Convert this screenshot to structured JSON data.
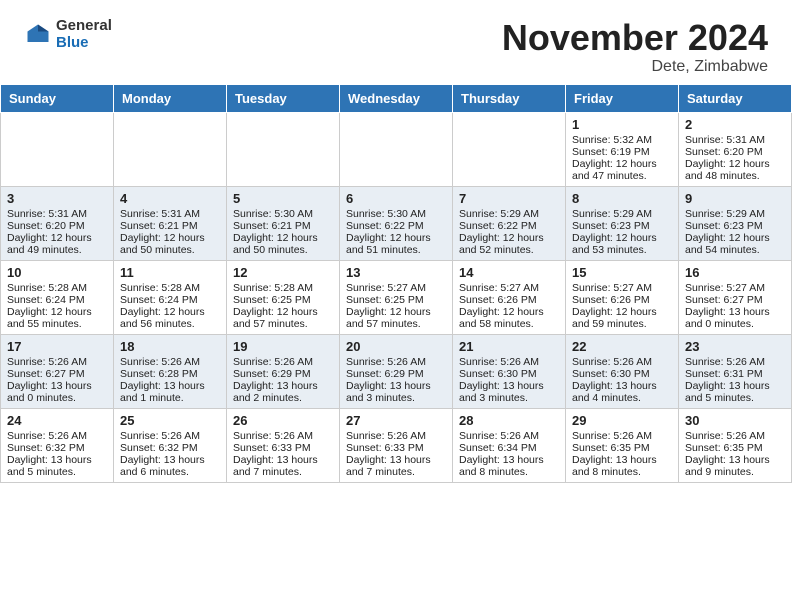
{
  "header": {
    "logo_general": "General",
    "logo_blue": "Blue",
    "month_title": "November 2024",
    "location": "Dete, Zimbabwe"
  },
  "weekdays": [
    "Sunday",
    "Monday",
    "Tuesday",
    "Wednesday",
    "Thursday",
    "Friday",
    "Saturday"
  ],
  "weeks": [
    [
      {
        "day": "",
        "sunrise": "",
        "sunset": "",
        "daylight": ""
      },
      {
        "day": "",
        "sunrise": "",
        "sunset": "",
        "daylight": ""
      },
      {
        "day": "",
        "sunrise": "",
        "sunset": "",
        "daylight": ""
      },
      {
        "day": "",
        "sunrise": "",
        "sunset": "",
        "daylight": ""
      },
      {
        "day": "",
        "sunrise": "",
        "sunset": "",
        "daylight": ""
      },
      {
        "day": "1",
        "sunrise": "Sunrise: 5:32 AM",
        "sunset": "Sunset: 6:19 PM",
        "daylight": "Daylight: 12 hours and 47 minutes."
      },
      {
        "day": "2",
        "sunrise": "Sunrise: 5:31 AM",
        "sunset": "Sunset: 6:20 PM",
        "daylight": "Daylight: 12 hours and 48 minutes."
      }
    ],
    [
      {
        "day": "3",
        "sunrise": "Sunrise: 5:31 AM",
        "sunset": "Sunset: 6:20 PM",
        "daylight": "Daylight: 12 hours and 49 minutes."
      },
      {
        "day": "4",
        "sunrise": "Sunrise: 5:31 AM",
        "sunset": "Sunset: 6:21 PM",
        "daylight": "Daylight: 12 hours and 50 minutes."
      },
      {
        "day": "5",
        "sunrise": "Sunrise: 5:30 AM",
        "sunset": "Sunset: 6:21 PM",
        "daylight": "Daylight: 12 hours and 50 minutes."
      },
      {
        "day": "6",
        "sunrise": "Sunrise: 5:30 AM",
        "sunset": "Sunset: 6:22 PM",
        "daylight": "Daylight: 12 hours and 51 minutes."
      },
      {
        "day": "7",
        "sunrise": "Sunrise: 5:29 AM",
        "sunset": "Sunset: 6:22 PM",
        "daylight": "Daylight: 12 hours and 52 minutes."
      },
      {
        "day": "8",
        "sunrise": "Sunrise: 5:29 AM",
        "sunset": "Sunset: 6:23 PM",
        "daylight": "Daylight: 12 hours and 53 minutes."
      },
      {
        "day": "9",
        "sunrise": "Sunrise: 5:29 AM",
        "sunset": "Sunset: 6:23 PM",
        "daylight": "Daylight: 12 hours and 54 minutes."
      }
    ],
    [
      {
        "day": "10",
        "sunrise": "Sunrise: 5:28 AM",
        "sunset": "Sunset: 6:24 PM",
        "daylight": "Daylight: 12 hours and 55 minutes."
      },
      {
        "day": "11",
        "sunrise": "Sunrise: 5:28 AM",
        "sunset": "Sunset: 6:24 PM",
        "daylight": "Daylight: 12 hours and 56 minutes."
      },
      {
        "day": "12",
        "sunrise": "Sunrise: 5:28 AM",
        "sunset": "Sunset: 6:25 PM",
        "daylight": "Daylight: 12 hours and 57 minutes."
      },
      {
        "day": "13",
        "sunrise": "Sunrise: 5:27 AM",
        "sunset": "Sunset: 6:25 PM",
        "daylight": "Daylight: 12 hours and 57 minutes."
      },
      {
        "day": "14",
        "sunrise": "Sunrise: 5:27 AM",
        "sunset": "Sunset: 6:26 PM",
        "daylight": "Daylight: 12 hours and 58 minutes."
      },
      {
        "day": "15",
        "sunrise": "Sunrise: 5:27 AM",
        "sunset": "Sunset: 6:26 PM",
        "daylight": "Daylight: 12 hours and 59 minutes."
      },
      {
        "day": "16",
        "sunrise": "Sunrise: 5:27 AM",
        "sunset": "Sunset: 6:27 PM",
        "daylight": "Daylight: 13 hours and 0 minutes."
      }
    ],
    [
      {
        "day": "17",
        "sunrise": "Sunrise: 5:26 AM",
        "sunset": "Sunset: 6:27 PM",
        "daylight": "Daylight: 13 hours and 0 minutes."
      },
      {
        "day": "18",
        "sunrise": "Sunrise: 5:26 AM",
        "sunset": "Sunset: 6:28 PM",
        "daylight": "Daylight: 13 hours and 1 minute."
      },
      {
        "day": "19",
        "sunrise": "Sunrise: 5:26 AM",
        "sunset": "Sunset: 6:29 PM",
        "daylight": "Daylight: 13 hours and 2 minutes."
      },
      {
        "day": "20",
        "sunrise": "Sunrise: 5:26 AM",
        "sunset": "Sunset: 6:29 PM",
        "daylight": "Daylight: 13 hours and 3 minutes."
      },
      {
        "day": "21",
        "sunrise": "Sunrise: 5:26 AM",
        "sunset": "Sunset: 6:30 PM",
        "daylight": "Daylight: 13 hours and 3 minutes."
      },
      {
        "day": "22",
        "sunrise": "Sunrise: 5:26 AM",
        "sunset": "Sunset: 6:30 PM",
        "daylight": "Daylight: 13 hours and 4 minutes."
      },
      {
        "day": "23",
        "sunrise": "Sunrise: 5:26 AM",
        "sunset": "Sunset: 6:31 PM",
        "daylight": "Daylight: 13 hours and 5 minutes."
      }
    ],
    [
      {
        "day": "24",
        "sunrise": "Sunrise: 5:26 AM",
        "sunset": "Sunset: 6:32 PM",
        "daylight": "Daylight: 13 hours and 5 minutes."
      },
      {
        "day": "25",
        "sunrise": "Sunrise: 5:26 AM",
        "sunset": "Sunset: 6:32 PM",
        "daylight": "Daylight: 13 hours and 6 minutes."
      },
      {
        "day": "26",
        "sunrise": "Sunrise: 5:26 AM",
        "sunset": "Sunset: 6:33 PM",
        "daylight": "Daylight: 13 hours and 7 minutes."
      },
      {
        "day": "27",
        "sunrise": "Sunrise: 5:26 AM",
        "sunset": "Sunset: 6:33 PM",
        "daylight": "Daylight: 13 hours and 7 minutes."
      },
      {
        "day": "28",
        "sunrise": "Sunrise: 5:26 AM",
        "sunset": "Sunset: 6:34 PM",
        "daylight": "Daylight: 13 hours and 8 minutes."
      },
      {
        "day": "29",
        "sunrise": "Sunrise: 5:26 AM",
        "sunset": "Sunset: 6:35 PM",
        "daylight": "Daylight: 13 hours and 8 minutes."
      },
      {
        "day": "30",
        "sunrise": "Sunrise: 5:26 AM",
        "sunset": "Sunset: 6:35 PM",
        "daylight": "Daylight: 13 hours and 9 minutes."
      }
    ]
  ]
}
